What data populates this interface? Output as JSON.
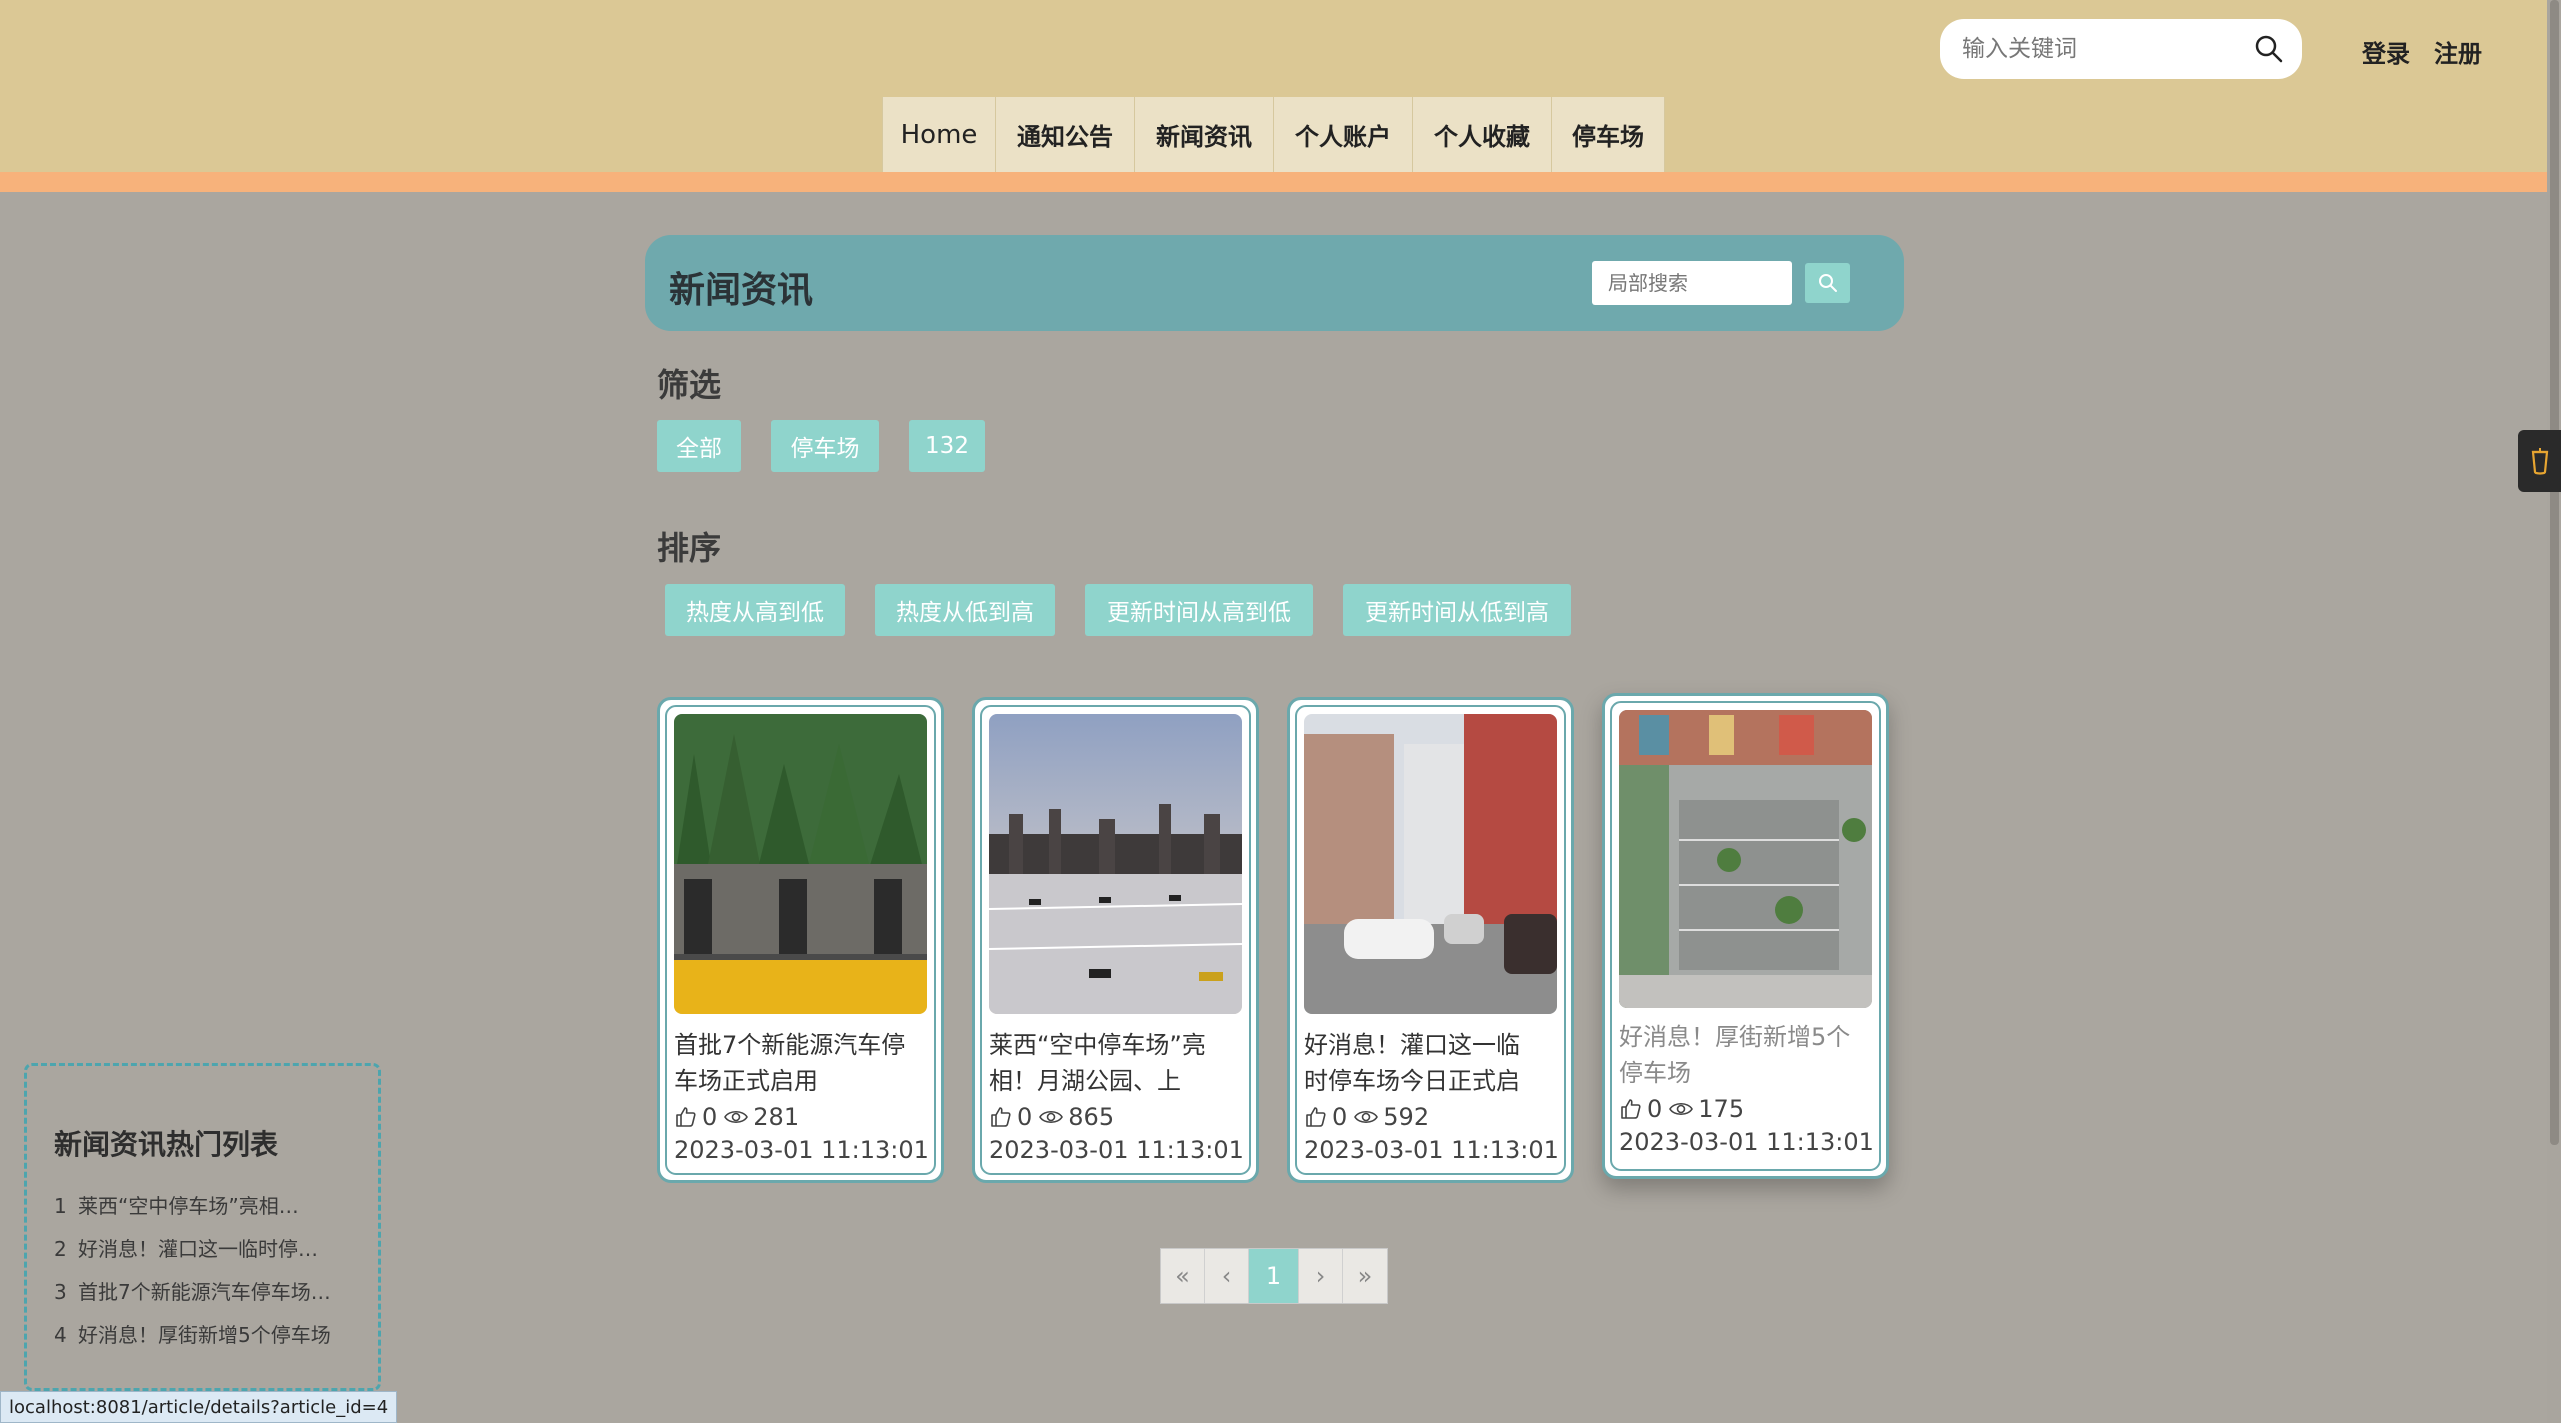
{
  "header": {
    "search_placeholder": "输入关键词",
    "login_label": "登录",
    "register_label": "注册",
    "nav": [
      "Home",
      "通知公告",
      "新闻资讯",
      "个人账户",
      "个人收藏",
      "停车场"
    ]
  },
  "section": {
    "title": "新闻资讯",
    "local_search_placeholder": "局部搜索"
  },
  "filter": {
    "label": "筛选",
    "tags": [
      "全部",
      "停车场",
      "132"
    ]
  },
  "sort": {
    "label": "排序",
    "options": [
      "热度从高到低",
      "热度从低到高",
      "更新时间从高到低",
      "更新时间从低到高"
    ]
  },
  "cards": [
    {
      "title": "首批7个新能源汽车停车场正式启用",
      "likes": "0",
      "views": "281",
      "date": "2023-03-01 11:13:01"
    },
    {
      "title": "莱西“空中停车场”亮相！月湖公园、上海…",
      "likes": "0",
      "views": "865",
      "date": "2023-03-01 11:13:01"
    },
    {
      "title": "好消息！灌口这一临时停车场今日正式启用",
      "likes": "0",
      "views": "592",
      "date": "2023-03-01 11:13:01"
    },
    {
      "title": "好消息！厚街新增5个停车场",
      "likes": "0",
      "views": "175",
      "date": "2023-03-01 11:13:01"
    }
  ],
  "pagination": {
    "first": "«",
    "prev": "‹",
    "current": "1",
    "next": "›",
    "last": "»"
  },
  "hot_list": {
    "title": "新闻资讯热门列表",
    "items": [
      {
        "num": "1",
        "text": "莱西“空中停车场”亮相…"
      },
      {
        "num": "2",
        "text": "好消息！灌口这一临时停…"
      },
      {
        "num": "3",
        "text": "首批7个新能源汽车停车场…"
      },
      {
        "num": "4",
        "text": "好消息！厚街新增5个停车场"
      }
    ]
  },
  "status_url": "localhost:8081/article/details?article_id=4",
  "colors": {
    "header_bg": "#dbc895",
    "accent_strip": "#f7b27b",
    "teal": "#6fa9ad",
    "tag": "#8fd4cc",
    "page_bg": "#aaa69f"
  }
}
